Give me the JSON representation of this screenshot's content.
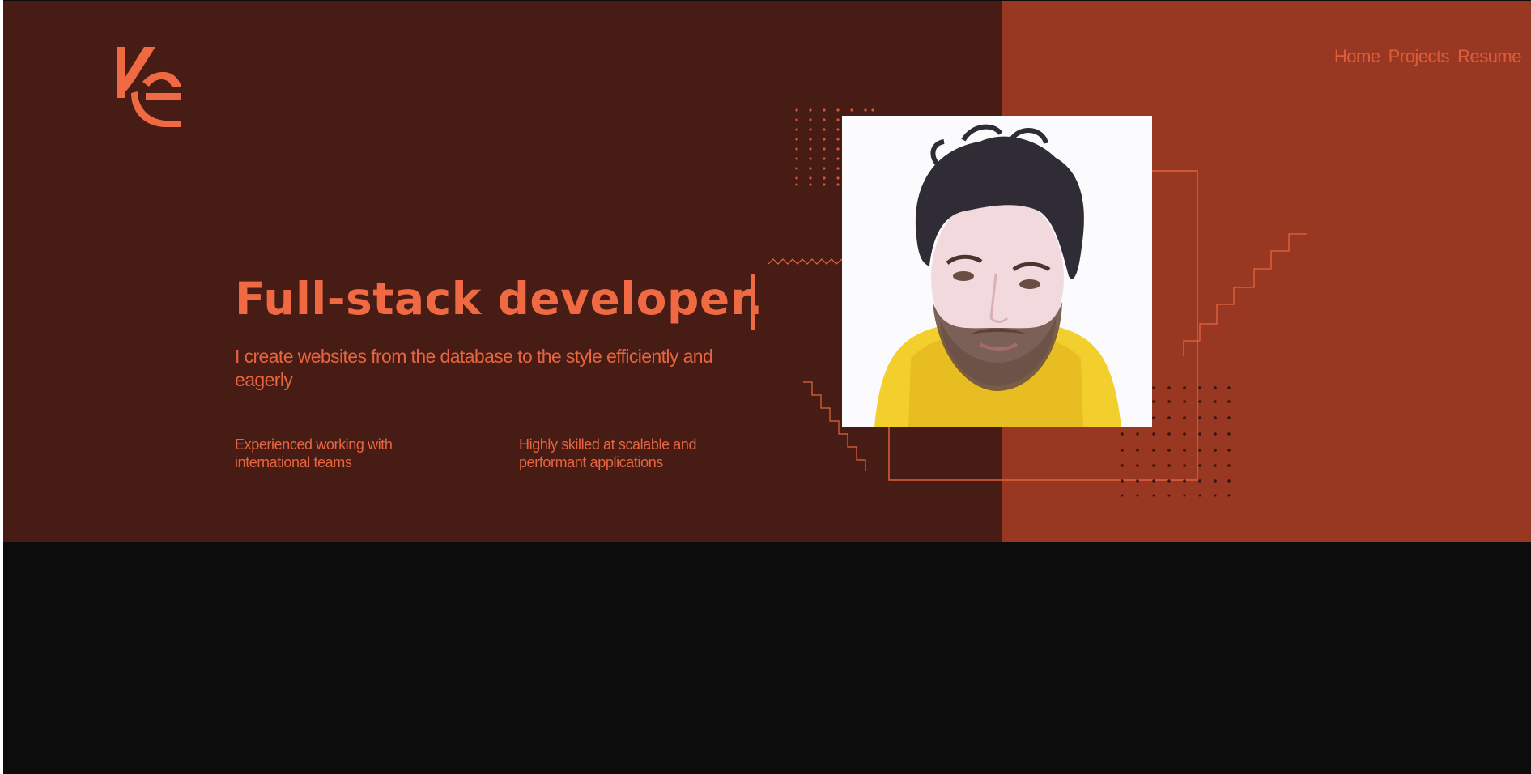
{
  "nav": {
    "items": [
      {
        "label": "Home"
      },
      {
        "label": "Projects"
      },
      {
        "label": "Resume"
      }
    ]
  },
  "hero": {
    "headline": "Full-stack developer.",
    "subtitle": "I create websites from the database to the style efficiently and eagerly",
    "features": [
      {
        "text": "Experienced working with international teams"
      },
      {
        "text": "Highly skilled at scalable and performant applications"
      }
    ]
  },
  "brand": {
    "logo_text": "KC",
    "accent": "#ef6a43",
    "dark": "#461c15",
    "rust": "#983722",
    "bottom": "#0c0c0c"
  },
  "icons": {
    "logo": "kc-monogram-logo",
    "cursor": "text-cursor"
  }
}
